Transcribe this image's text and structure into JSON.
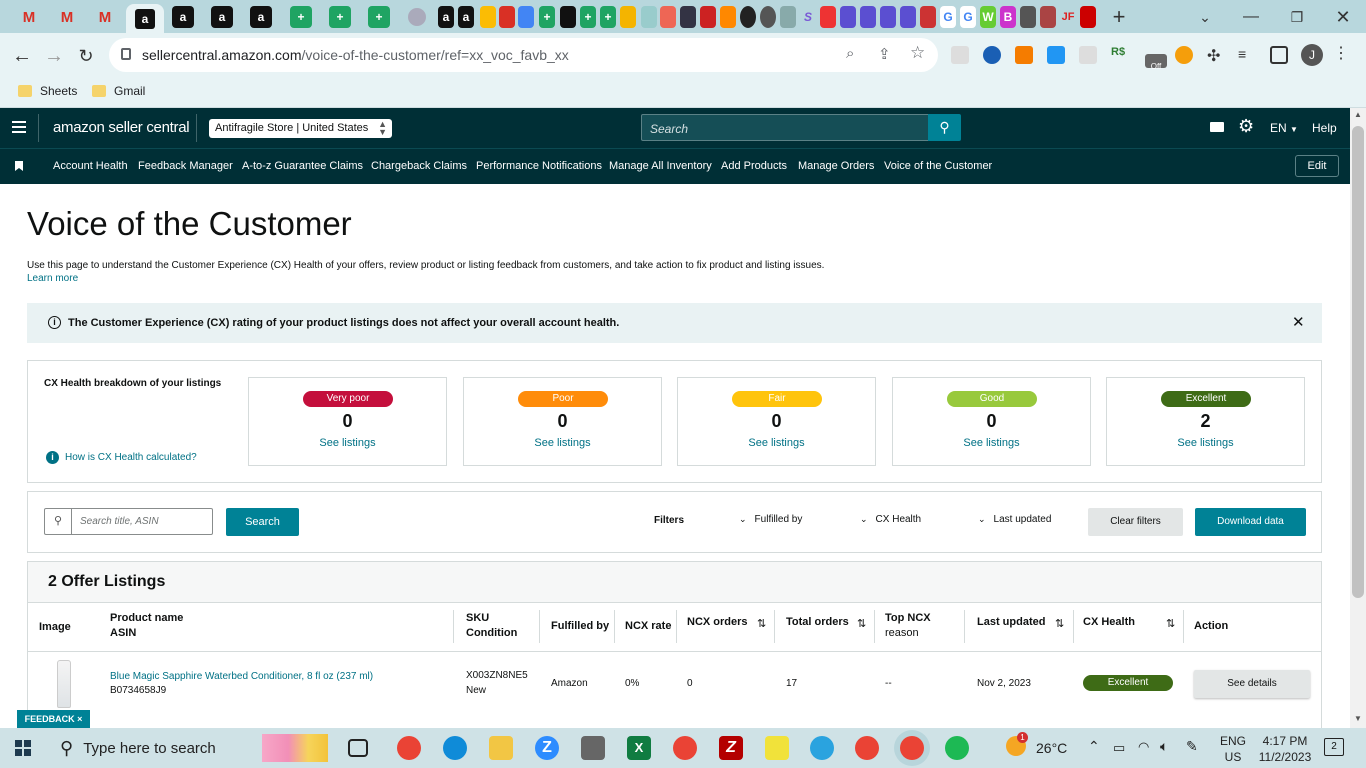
{
  "browser": {
    "url_domain": "sellercentral.amazon.com",
    "url_path": "/voice-of-the-customer/ref=xx_voc_favb_xx",
    "bookmarks": [
      "Sheets",
      "Gmail"
    ],
    "profile_initial": "J",
    "ext_off_badge": "Off"
  },
  "header": {
    "logo": "amazon seller central",
    "store": "Antifragile Store | United States",
    "search_placeholder": "Search",
    "lang": "EN",
    "help": "Help"
  },
  "nav": {
    "links": [
      "Account Health",
      "Feedback Manager",
      "A-to-z Guarantee Claims",
      "Chargeback Claims",
      "Performance Notifications",
      "Manage All Inventory",
      "Add Products",
      "Manage Orders",
      "Voice of the Customer"
    ],
    "edit": "Edit"
  },
  "page": {
    "title": "Voice of the Customer",
    "description": "Use this page to understand the Customer Experience (CX) Health of your offers, review product or listing feedback from customers, and take action to fix product and listing issues.",
    "learn_more": "Learn more",
    "banner": "The Customer Experience (CX) rating of your product listings does not affect your overall account health."
  },
  "cx": {
    "heading": "CX Health breakdown of your listings",
    "how_link": "How is CX Health calculated?",
    "see_listings": "See listings",
    "buckets": [
      {
        "label": "Very poor",
        "count": "0",
        "color": "#c40f3c"
      },
      {
        "label": "Poor",
        "count": "0",
        "color": "#ff8c0a"
      },
      {
        "label": "Fair",
        "count": "0",
        "color": "#ffc40c"
      },
      {
        "label": "Good",
        "count": "0",
        "color": "#98c93c"
      },
      {
        "label": "Excellent",
        "count": "2",
        "color": "#3e6b16"
      }
    ]
  },
  "filters": {
    "search_placeholder": "Search title, ASIN",
    "search_btn": "Search",
    "filters_label": "Filters",
    "fulfilled_by": "Fulfilled by",
    "cx_health": "CX Health",
    "last_updated": "Last updated",
    "clear": "Clear filters",
    "download": "Download data"
  },
  "table": {
    "title": "2 Offer Listings",
    "headers": {
      "image": "Image",
      "product": "Product name",
      "asin": "ASIN",
      "sku": "SKU",
      "condition": "Condition",
      "fulfilled": "Fulfilled by",
      "ncx_rate": "NCX rate",
      "ncx_orders": "NCX orders",
      "total_orders": "Total orders",
      "top_ncx_1": "Top NCX",
      "top_ncx_2": "reason",
      "last_updated": "Last updated",
      "cx_health": "CX Health",
      "action": "Action"
    },
    "rows": [
      {
        "name": "Blue Magic Sapphire Waterbed Conditioner, 8 fl oz (237 ml)",
        "asin": "B0734658J9",
        "sku": "X003ZN8NE5",
        "condition": "New",
        "fulfilled": "Amazon",
        "ncx_rate": "0%",
        "ncx_orders": "0",
        "total_orders": "17",
        "top_reason": "--",
        "last_updated": "Nov 2, 2023",
        "cx": "Excellent",
        "action": "See details"
      }
    ]
  },
  "feedback": "FEEDBACK ×",
  "taskbar": {
    "search": "Type here to search",
    "weather": "26°C",
    "lang1": "ENG",
    "lang2": "US",
    "time": "4:17 PM",
    "date": "11/2/2023",
    "notif": "2",
    "badge": "1"
  }
}
